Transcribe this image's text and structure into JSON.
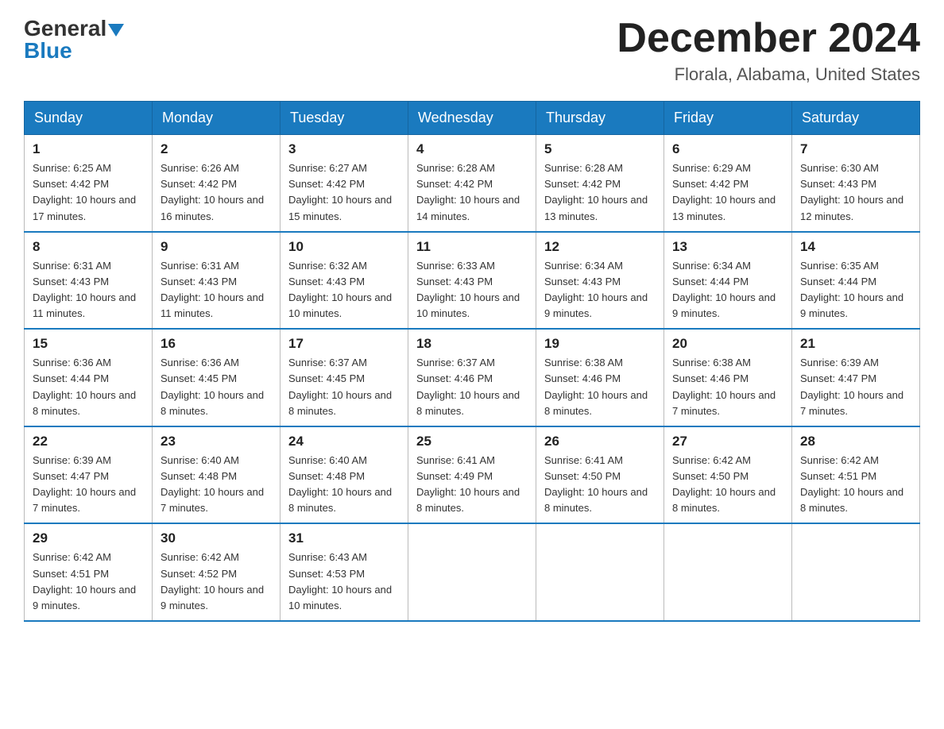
{
  "logo": {
    "general": "General",
    "blue": "Blue"
  },
  "title": "December 2024",
  "location": "Florala, Alabama, United States",
  "days_header": [
    "Sunday",
    "Monday",
    "Tuesday",
    "Wednesday",
    "Thursday",
    "Friday",
    "Saturday"
  ],
  "weeks": [
    [
      {
        "day": "1",
        "sunrise": "6:25 AM",
        "sunset": "4:42 PM",
        "daylight": "10 hours and 17 minutes."
      },
      {
        "day": "2",
        "sunrise": "6:26 AM",
        "sunset": "4:42 PM",
        "daylight": "10 hours and 16 minutes."
      },
      {
        "day": "3",
        "sunrise": "6:27 AM",
        "sunset": "4:42 PM",
        "daylight": "10 hours and 15 minutes."
      },
      {
        "day": "4",
        "sunrise": "6:28 AM",
        "sunset": "4:42 PM",
        "daylight": "10 hours and 14 minutes."
      },
      {
        "day": "5",
        "sunrise": "6:28 AM",
        "sunset": "4:42 PM",
        "daylight": "10 hours and 13 minutes."
      },
      {
        "day": "6",
        "sunrise": "6:29 AM",
        "sunset": "4:42 PM",
        "daylight": "10 hours and 13 minutes."
      },
      {
        "day": "7",
        "sunrise": "6:30 AM",
        "sunset": "4:43 PM",
        "daylight": "10 hours and 12 minutes."
      }
    ],
    [
      {
        "day": "8",
        "sunrise": "6:31 AM",
        "sunset": "4:43 PM",
        "daylight": "10 hours and 11 minutes."
      },
      {
        "day": "9",
        "sunrise": "6:31 AM",
        "sunset": "4:43 PM",
        "daylight": "10 hours and 11 minutes."
      },
      {
        "day": "10",
        "sunrise": "6:32 AM",
        "sunset": "4:43 PM",
        "daylight": "10 hours and 10 minutes."
      },
      {
        "day": "11",
        "sunrise": "6:33 AM",
        "sunset": "4:43 PM",
        "daylight": "10 hours and 10 minutes."
      },
      {
        "day": "12",
        "sunrise": "6:34 AM",
        "sunset": "4:43 PM",
        "daylight": "10 hours and 9 minutes."
      },
      {
        "day": "13",
        "sunrise": "6:34 AM",
        "sunset": "4:44 PM",
        "daylight": "10 hours and 9 minutes."
      },
      {
        "day": "14",
        "sunrise": "6:35 AM",
        "sunset": "4:44 PM",
        "daylight": "10 hours and 9 minutes."
      }
    ],
    [
      {
        "day": "15",
        "sunrise": "6:36 AM",
        "sunset": "4:44 PM",
        "daylight": "10 hours and 8 minutes."
      },
      {
        "day": "16",
        "sunrise": "6:36 AM",
        "sunset": "4:45 PM",
        "daylight": "10 hours and 8 minutes."
      },
      {
        "day": "17",
        "sunrise": "6:37 AM",
        "sunset": "4:45 PM",
        "daylight": "10 hours and 8 minutes."
      },
      {
        "day": "18",
        "sunrise": "6:37 AM",
        "sunset": "4:46 PM",
        "daylight": "10 hours and 8 minutes."
      },
      {
        "day": "19",
        "sunrise": "6:38 AM",
        "sunset": "4:46 PM",
        "daylight": "10 hours and 8 minutes."
      },
      {
        "day": "20",
        "sunrise": "6:38 AM",
        "sunset": "4:46 PM",
        "daylight": "10 hours and 7 minutes."
      },
      {
        "day": "21",
        "sunrise": "6:39 AM",
        "sunset": "4:47 PM",
        "daylight": "10 hours and 7 minutes."
      }
    ],
    [
      {
        "day": "22",
        "sunrise": "6:39 AM",
        "sunset": "4:47 PM",
        "daylight": "10 hours and 7 minutes."
      },
      {
        "day": "23",
        "sunrise": "6:40 AM",
        "sunset": "4:48 PM",
        "daylight": "10 hours and 7 minutes."
      },
      {
        "day": "24",
        "sunrise": "6:40 AM",
        "sunset": "4:48 PM",
        "daylight": "10 hours and 8 minutes."
      },
      {
        "day": "25",
        "sunrise": "6:41 AM",
        "sunset": "4:49 PM",
        "daylight": "10 hours and 8 minutes."
      },
      {
        "day": "26",
        "sunrise": "6:41 AM",
        "sunset": "4:50 PM",
        "daylight": "10 hours and 8 minutes."
      },
      {
        "day": "27",
        "sunrise": "6:42 AM",
        "sunset": "4:50 PM",
        "daylight": "10 hours and 8 minutes."
      },
      {
        "day": "28",
        "sunrise": "6:42 AM",
        "sunset": "4:51 PM",
        "daylight": "10 hours and 8 minutes."
      }
    ],
    [
      {
        "day": "29",
        "sunrise": "6:42 AM",
        "sunset": "4:51 PM",
        "daylight": "10 hours and 9 minutes."
      },
      {
        "day": "30",
        "sunrise": "6:42 AM",
        "sunset": "4:52 PM",
        "daylight": "10 hours and 9 minutes."
      },
      {
        "day": "31",
        "sunrise": "6:43 AM",
        "sunset": "4:53 PM",
        "daylight": "10 hours and 10 minutes."
      },
      null,
      null,
      null,
      null
    ]
  ]
}
